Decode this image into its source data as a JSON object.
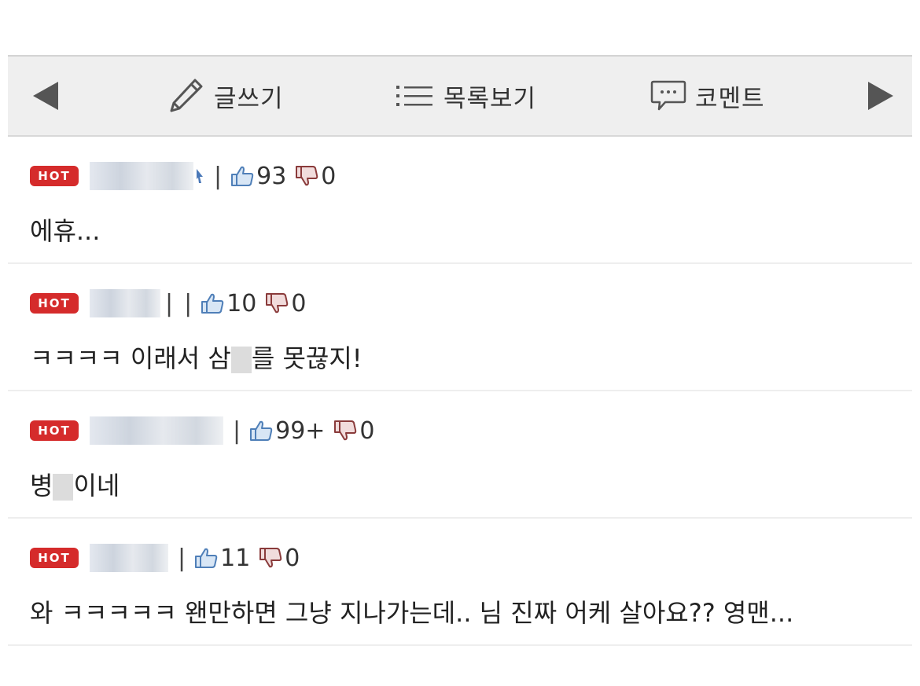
{
  "toolbar": {
    "write_label": "글쓰기",
    "list_label": "목록보기",
    "comment_label": "코멘트"
  },
  "comments": [
    {
      "badge": "HOT",
      "likes": "93",
      "dislikes": "0",
      "text_before": "에휴...",
      "text_after": ""
    },
    {
      "badge": "HOT",
      "likes": "10",
      "dislikes": "0",
      "text_before": "ㅋㅋㅋㅋ 이래서 삼",
      "text_after": "를 못끊지!"
    },
    {
      "badge": "HOT",
      "likes": "99+",
      "dislikes": "0",
      "text_before": "병",
      "text_after": "이네"
    },
    {
      "badge": "HOT",
      "likes": "11",
      "dislikes": "0",
      "text_before": "와 ㅋㅋㅋㅋㅋ 왠만하면 그냥 지나가는데.. 님 진짜 어케 살아요?? 영맨...",
      "text_after": ""
    }
  ]
}
